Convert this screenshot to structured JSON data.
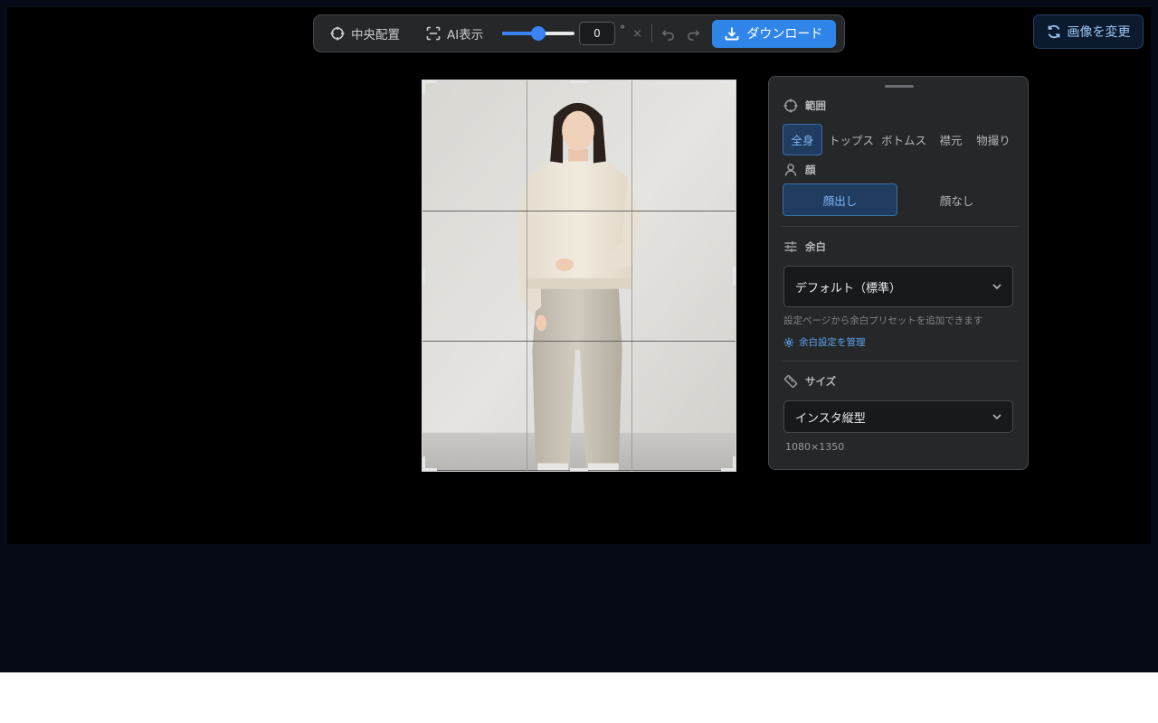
{
  "toolbar": {
    "center_label": "中央配置",
    "ai_label": "AI表示",
    "rotation": {
      "value": "0",
      "unit": "°",
      "fraction": 0.5
    },
    "clear_symbol": "×",
    "download_label": "ダウンロード"
  },
  "change_image_label": "画像を変更",
  "panel": {
    "range": {
      "title": "範囲",
      "options": [
        "全身",
        "トップス",
        "ボトムス",
        "襟元",
        "物撮り"
      ],
      "selected": "全身"
    },
    "face": {
      "title": "顔",
      "options": [
        "顔出し",
        "顔なし"
      ],
      "selected": "顔出し"
    },
    "margin": {
      "title": "余白",
      "value": "デフォルト（標準）",
      "hint": "設定ページから余白プリセットを追加できます",
      "link": "余白設定を管理"
    },
    "size": {
      "title": "サイズ",
      "value": "インスタ縦型",
      "dimensions": "1080×1350"
    }
  },
  "colors": {
    "accent": "#2f86e8",
    "stage": "#000000",
    "app_bg": "#050a16",
    "panel_bg": "#262729",
    "active_bg": "#203c60"
  }
}
